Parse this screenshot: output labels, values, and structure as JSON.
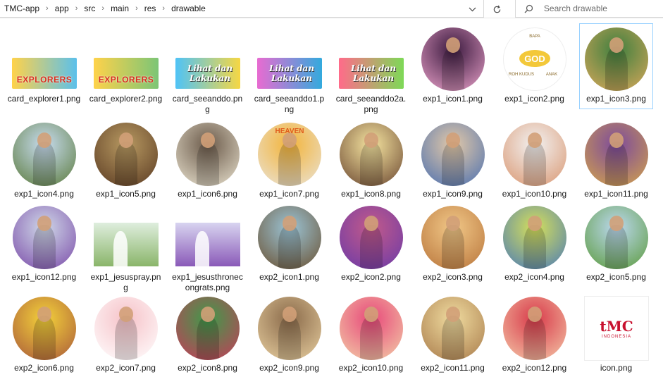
{
  "address_bar": {
    "breadcrumbs": [
      "TMC-app",
      "app",
      "src",
      "main",
      "res",
      "drawable"
    ],
    "separator": "›",
    "history_icon": "chevron-down-icon",
    "refresh_icon": "refresh-icon"
  },
  "search": {
    "placeholder": "Search drawable",
    "icon": "search-icon"
  },
  "files": [
    {
      "name": "card_explorer1.png",
      "kind": "banner",
      "text": "EXPLORERS",
      "colors": [
        "#ffd24a",
        "#5bc0eb"
      ]
    },
    {
      "name": "card_explorer2.png",
      "kind": "banner",
      "text": "EXPLORERS",
      "colors": [
        "#ffd24a",
        "#7cc576"
      ]
    },
    {
      "name": "card_seeanddo.png",
      "kind": "banner",
      "text": "Lihat dan Lakukan",
      "colors": [
        "#4fc3f7",
        "#f6d743"
      ]
    },
    {
      "name": "card_seeanddo1.png",
      "kind": "banner",
      "text": "Lihat dan Lakukan",
      "colors": [
        "#e86bd1",
        "#33aadd"
      ]
    },
    {
      "name": "card_seeanddo2a.png",
      "kind": "banner",
      "text": "Lihat dan Lakukan",
      "colors": [
        "#ff6b8a",
        "#7ed957"
      ]
    },
    {
      "name": "exp1_icon1.png",
      "kind": "circle",
      "colors": [
        "#3b1a3f",
        "#e8a0c8"
      ]
    },
    {
      "name": "exp1_icon2.png",
      "kind": "godcircle",
      "text": "GOD",
      "labels": [
        "BAPA",
        "ROH KUDUS",
        "ANAK"
      ]
    },
    {
      "name": "exp1_icon3.png",
      "kind": "circle",
      "colors": [
        "#3f7f3f",
        "#d9a85a"
      ],
      "selected": true
    },
    {
      "name": "exp1_icon4.png",
      "kind": "circle",
      "colors": [
        "#c8dcf0",
        "#5a7a3a"
      ]
    },
    {
      "name": "exp1_icon5.png",
      "kind": "circle",
      "colors": [
        "#b89a62",
        "#5a3a22"
      ]
    },
    {
      "name": "exp1_icon6.png",
      "kind": "circle",
      "colors": [
        "#6b5a4a",
        "#e9e2cf"
      ]
    },
    {
      "name": "exp1_icon7.png",
      "kind": "circle",
      "colors": [
        "#f3b43a",
        "#e9e3d8"
      ],
      "text": "HEAVEN"
    },
    {
      "name": "exp1_icon8.png",
      "kind": "circle",
      "colors": [
        "#f5e4a0",
        "#6a4630"
      ]
    },
    {
      "name": "exp1_icon9.png",
      "kind": "circle",
      "colors": [
        "#e3c9a8",
        "#4a6fb0"
      ]
    },
    {
      "name": "exp1_icon10.png",
      "kind": "circle",
      "colors": [
        "#f2f2f2",
        "#d99670"
      ]
    },
    {
      "name": "exp1_icon11.png",
      "kind": "circle",
      "colors": [
        "#7c4a9c",
        "#d4a44a"
      ]
    },
    {
      "name": "exp1_icon12.png",
      "kind": "circle",
      "colors": [
        "#cfd8e8",
        "#7a4aa8"
      ]
    },
    {
      "name": "exp1_jesuspray.png",
      "kind": "rect",
      "colors": [
        "#dfeede",
        "#8ab56a"
      ]
    },
    {
      "name": "exp1_jesusthronecongrats.png",
      "kind": "rect",
      "colors": [
        "#d8d4f0",
        "#8a5ab8"
      ]
    },
    {
      "name": "exp2_icon1.png",
      "kind": "circle",
      "colors": [
        "#9bc4d6",
        "#6a5030"
      ]
    },
    {
      "name": "exp2_icon2.png",
      "kind": "circle",
      "colors": [
        "#c25a8a",
        "#6a3aa8"
      ]
    },
    {
      "name": "exp2_icon3.png",
      "kind": "circle",
      "colors": [
        "#f1c888",
        "#b8743a"
      ]
    },
    {
      "name": "exp2_icon4.png",
      "kind": "circle",
      "colors": [
        "#d6e05a",
        "#4a7ab8"
      ]
    },
    {
      "name": "exp2_icon5.png",
      "kind": "circle",
      "colors": [
        "#bcd8f0",
        "#5a9a3a"
      ]
    },
    {
      "name": "exp2_icon6.png",
      "kind": "circle",
      "colors": [
        "#f4d23a",
        "#a8583a"
      ]
    },
    {
      "name": "exp2_icon7.png",
      "kind": "circle",
      "colors": [
        "#f6c2c8",
        "#ffffff"
      ]
    },
    {
      "name": "exp2_icon8.png",
      "kind": "circle",
      "colors": [
        "#3f9a4a",
        "#c83a5a"
      ]
    },
    {
      "name": "exp2_icon9.png",
      "kind": "circle",
      "colors": [
        "#8a6a4a",
        "#e8cfa0"
      ]
    },
    {
      "name": "exp2_icon10.png",
      "kind": "circle",
      "colors": [
        "#e8487a",
        "#f2d0a8"
      ]
    },
    {
      "name": "exp2_icon11.png",
      "kind": "circle",
      "colors": [
        "#f0dca0",
        "#a87a4a"
      ]
    },
    {
      "name": "exp2_icon12.png",
      "kind": "circle",
      "colors": [
        "#d83a4a",
        "#f4c8a8"
      ]
    },
    {
      "name": "icon.png",
      "kind": "tmc",
      "text": "tMC",
      "sub": "INDONESIA"
    }
  ]
}
